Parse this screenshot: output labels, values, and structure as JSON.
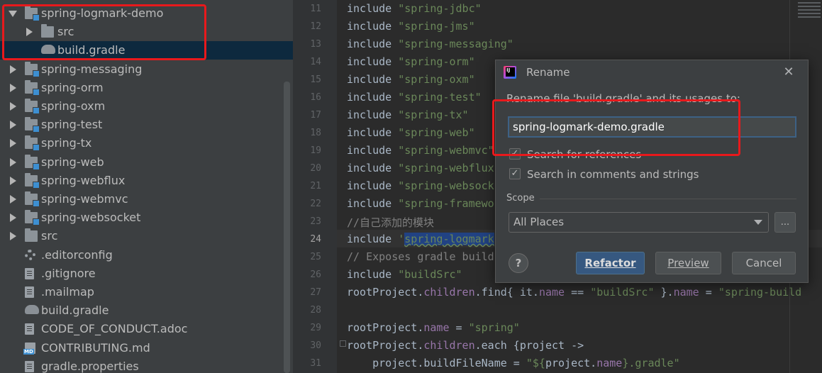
{
  "tree": {
    "items": [
      {
        "label": "spring-logmark-demo",
        "icon": "module-folder-icon",
        "arrow": "expanded",
        "name": "tree-item-spring-logmark-demo"
      },
      {
        "label": "src",
        "icon": "folder-icon",
        "arrow": "collapsed",
        "name": "tree-item-src-child"
      },
      {
        "label": "build.gradle",
        "icon": "gradle-icon",
        "arrow": "none",
        "name": "tree-item-build-gradle-child",
        "selected": true
      },
      {
        "label": "spring-messaging",
        "icon": "module-folder-icon",
        "arrow": "collapsed",
        "name": "tree-item-spring-messaging"
      },
      {
        "label": "spring-orm",
        "icon": "module-folder-icon",
        "arrow": "collapsed",
        "name": "tree-item-spring-orm"
      },
      {
        "label": "spring-oxm",
        "icon": "module-folder-icon",
        "arrow": "collapsed",
        "name": "tree-item-spring-oxm"
      },
      {
        "label": "spring-test",
        "icon": "module-folder-icon",
        "arrow": "collapsed",
        "name": "tree-item-spring-test"
      },
      {
        "label": "spring-tx",
        "icon": "module-folder-icon",
        "arrow": "collapsed",
        "name": "tree-item-spring-tx"
      },
      {
        "label": "spring-web",
        "icon": "module-folder-icon",
        "arrow": "collapsed",
        "name": "tree-item-spring-web"
      },
      {
        "label": "spring-webflux",
        "icon": "module-folder-icon",
        "arrow": "collapsed",
        "name": "tree-item-spring-webflux"
      },
      {
        "label": "spring-webmvc",
        "icon": "module-folder-icon",
        "arrow": "collapsed",
        "name": "tree-item-spring-webmvc"
      },
      {
        "label": "spring-websocket",
        "icon": "module-folder-icon",
        "arrow": "collapsed",
        "name": "tree-item-spring-websocket"
      },
      {
        "label": "src",
        "icon": "folder-icon",
        "arrow": "collapsed",
        "name": "tree-item-src"
      },
      {
        "label": ".editorconfig",
        "icon": "gear-icon",
        "arrow": "none",
        "name": "tree-item-editorconfig"
      },
      {
        "label": ".gitignore",
        "icon": "file-icon",
        "arrow": "none",
        "name": "tree-item-gitignore"
      },
      {
        "label": ".mailmap",
        "icon": "file-icon",
        "arrow": "none",
        "name": "tree-item-mailmap"
      },
      {
        "label": "build.gradle",
        "icon": "gradle-icon",
        "arrow": "none",
        "name": "tree-item-build-gradle"
      },
      {
        "label": "CODE_OF_CONDUCT.adoc",
        "icon": "file-icon",
        "arrow": "none",
        "name": "tree-item-code-of-conduct"
      },
      {
        "label": "CONTRIBUTING.md",
        "icon": "markdown-icon",
        "arrow": "none",
        "name": "tree-item-contributing"
      },
      {
        "label": "gradle.properties",
        "icon": "file-icon",
        "arrow": "none",
        "name": "tree-item-gradle-properties"
      }
    ]
  },
  "editor": {
    "current_line": 24,
    "lines": [
      {
        "n": "11",
        "parts": [
          [
            "t",
            "include "
          ],
          [
            "s",
            "\"spring-jdbc\""
          ]
        ]
      },
      {
        "n": "12",
        "parts": [
          [
            "t",
            "include "
          ],
          [
            "s",
            "\"spring-jms\""
          ]
        ]
      },
      {
        "n": "13",
        "parts": [
          [
            "t",
            "include "
          ],
          [
            "s",
            "\"spring-messaging\""
          ]
        ]
      },
      {
        "n": "14",
        "parts": [
          [
            "t",
            "include "
          ],
          [
            "s",
            "\"spring-orm\""
          ]
        ]
      },
      {
        "n": "15",
        "parts": [
          [
            "t",
            "include "
          ],
          [
            "s",
            "\"spring-oxm\""
          ]
        ]
      },
      {
        "n": "16",
        "parts": [
          [
            "t",
            "include "
          ],
          [
            "s",
            "\"spring-test\""
          ]
        ]
      },
      {
        "n": "17",
        "parts": [
          [
            "t",
            "include "
          ],
          [
            "s",
            "\"spring-tx\""
          ]
        ]
      },
      {
        "n": "18",
        "parts": [
          [
            "t",
            "include "
          ],
          [
            "s",
            "\"spring-web\""
          ]
        ]
      },
      {
        "n": "19",
        "parts": [
          [
            "t",
            "include "
          ],
          [
            "s",
            "\"spring-webmvc\""
          ]
        ]
      },
      {
        "n": "20",
        "parts": [
          [
            "t",
            "include "
          ],
          [
            "s",
            "\"spring-webflux"
          ]
        ]
      },
      {
        "n": "21",
        "parts": [
          [
            "t",
            "include "
          ],
          [
            "s",
            "\"spring-websock"
          ]
        ]
      },
      {
        "n": "22",
        "parts": [
          [
            "t",
            "include "
          ],
          [
            "s",
            "\"spring-framewo"
          ]
        ]
      },
      {
        "n": "23",
        "parts": [
          [
            "c",
            "//自己添加的模块"
          ]
        ]
      },
      {
        "n": "24",
        "parts": [
          [
            "t",
            "include "
          ],
          [
            "s",
            "'"
          ],
          [
            "h",
            "spring-logmark"
          ]
        ]
      },
      {
        "n": "25",
        "parts": [
          [
            "c",
            "// Exposes gradle build"
          ]
        ]
      },
      {
        "n": "26",
        "parts": [
          [
            "t",
            "include "
          ],
          [
            "s",
            "\"buildSrc\""
          ]
        ]
      },
      {
        "n": "27",
        "parts": [
          [
            "t",
            "rootProject."
          ],
          [
            "f",
            "children"
          ],
          [
            "t",
            ".find{ it."
          ],
          [
            "f",
            "name"
          ],
          [
            "t",
            " == "
          ],
          [
            "s",
            "\"buildSrc\""
          ],
          [
            "t",
            " }."
          ],
          [
            "f",
            "name"
          ],
          [
            "t",
            " = "
          ],
          [
            "s",
            "\"spring-build"
          ]
        ]
      },
      {
        "n": "28",
        "parts": []
      },
      {
        "n": "29",
        "parts": [
          [
            "t",
            "rootProject."
          ],
          [
            "f",
            "name"
          ],
          [
            "t",
            " = "
          ],
          [
            "s",
            "\"spring\""
          ]
        ]
      },
      {
        "n": "30",
        "parts": [
          [
            "t",
            "rootProject."
          ],
          [
            "f",
            "children"
          ],
          [
            "t",
            ".each {project ->"
          ]
        ]
      },
      {
        "n": "31",
        "parts": [
          [
            "t",
            "    project.buildFileName = "
          ],
          [
            "s",
            "\"${"
          ],
          [
            "t",
            "project."
          ],
          [
            "f",
            "name"
          ],
          [
            "s",
            "}.gradle\""
          ]
        ]
      }
    ]
  },
  "dialog": {
    "title": "Rename",
    "description": "Rename file 'build.gradle' and its usages to:",
    "new_name": "spring-logmark-demo.gradle",
    "search_references": {
      "label": "Search for references",
      "checked": true
    },
    "search_comments": {
      "label": "Search in comments and strings",
      "checked": true
    },
    "scope_label": "Scope",
    "scope_value": "All Places",
    "scope_more": "...",
    "help": "?",
    "refactor": "Refactor",
    "preview": "Preview",
    "cancel": "Cancel",
    "close_icon": "close-icon"
  },
  "colors": {
    "annotation": "#e8191c",
    "primary_button": "#365880",
    "selection": "#0d293e"
  }
}
